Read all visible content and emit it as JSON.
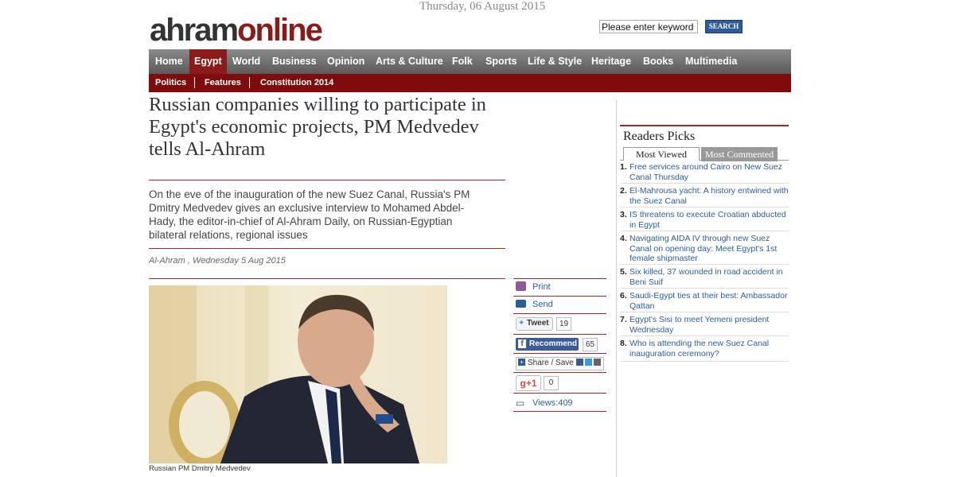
{
  "header": {
    "date": "Thursday, 06 August 2015",
    "logo_part1": "ahram",
    "logo_part2": "online",
    "search_placeholder": "Please enter keyword",
    "search_button": "SEARCH"
  },
  "nav": {
    "items": [
      "Home",
      "Egypt",
      "World",
      "Business",
      "Opinion",
      "Arts & Culture",
      "Folk",
      "Sports",
      "Life & Style",
      "Heritage",
      "Books",
      "Multimedia"
    ],
    "active": "Egypt"
  },
  "subnav": {
    "items": [
      "Politics",
      "Features",
      "Constitution 2014"
    ]
  },
  "article": {
    "headline": "Russian companies willing to participate in Egypt's economic projects, PM Medvedev tells Al-Ahram",
    "lead": "On the eve of the inauguration of the new Suez Canal, Russia's PM Dmitry Medvedev gives an exclusive interview to Mohamed Abdel-Hady, the editor-in-chief of Al-Ahram Daily, on Russian-Egyptian bilateral relations, regional issues",
    "byline": "Al-Ahram , Wednesday 5 Aug 2015",
    "caption": "Russian PM Dmitry Medvedev"
  },
  "share": {
    "print": "Print",
    "send": "Send",
    "tweet": "Tweet",
    "tweet_count": "19",
    "recommend": "Recommend",
    "recommend_count": "65",
    "share_save": "Share / Save",
    "gplus": "g+1",
    "gplus_count": "0",
    "views": "Views:409"
  },
  "readers_picks": {
    "title": "Readers Picks",
    "tabs": [
      "Most Viewed",
      "Most Commented"
    ],
    "active_tab": "Most Viewed",
    "items": [
      {
        "num": "1.",
        "text": "Free services around Cairo on New Suez Canal Thursday"
      },
      {
        "num": "2.",
        "text": "El-Mahrousa yacht: A history entwined with the Suez Canal"
      },
      {
        "num": "3.",
        "text": "IS threatens to execute Croatian abducted in Egypt"
      },
      {
        "num": "4.",
        "text": "Navigating AIDA IV through new Suez Canal on opening day: Meet Egypt's 1st female shipmaster"
      },
      {
        "num": "5.",
        "text": "Six killed, 37 wounded in road accident in Beni Suif"
      },
      {
        "num": "6.",
        "text": "Saudi-Egypt ties at their best: Ambassador Qattan"
      },
      {
        "num": "7.",
        "text": "Egypt's Sisi to meet Yemeni president Wednesday"
      },
      {
        "num": "8.",
        "text": "Who is attending the new Suez Canal inauguration ceremony?"
      }
    ]
  },
  "colors": {
    "brand": "#8b1a1a",
    "link": "#2e5c9a",
    "nav_gray": "#6e6e6e"
  }
}
